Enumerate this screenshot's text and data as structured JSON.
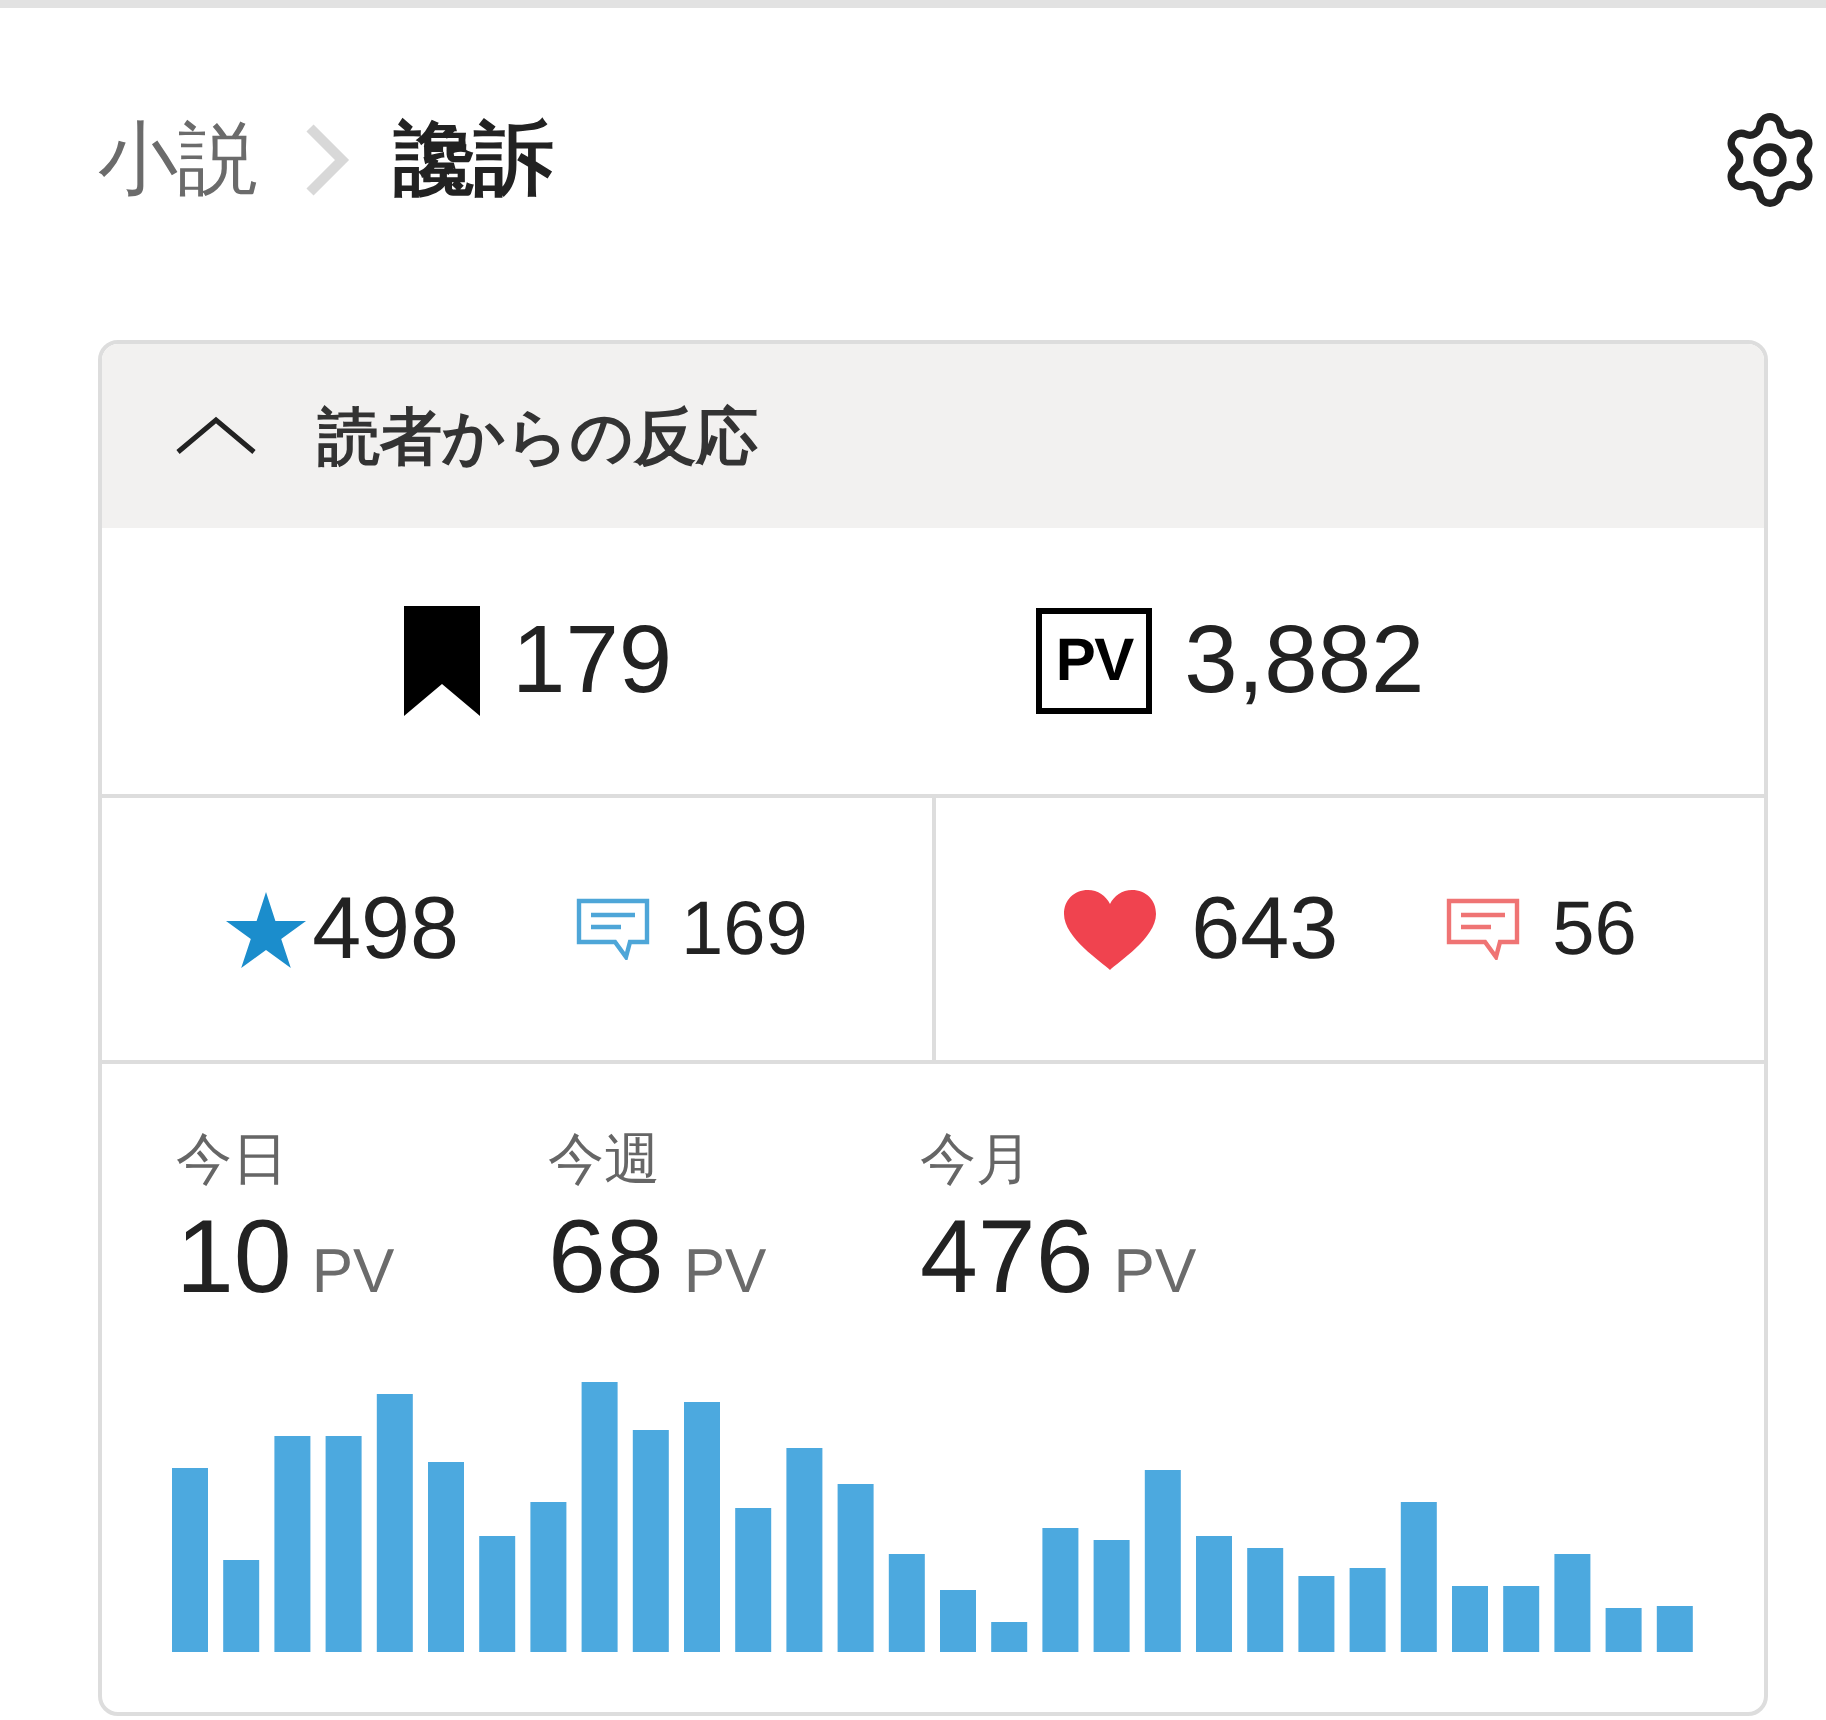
{
  "breadcrumb": [
    {
      "label": "小説",
      "current": false
    },
    {
      "label": "讒訴",
      "current": true
    }
  ],
  "panel": {
    "title": "読者からの反応",
    "expanded": true,
    "totals": [
      {
        "kind": "bookmarks",
        "value": "179"
      },
      {
        "kind": "page_views",
        "badge": "PV",
        "value": "3,882"
      }
    ],
    "reactions": [
      {
        "kind": "star",
        "count": "498",
        "comments": "169"
      },
      {
        "kind": "heart",
        "count": "643",
        "comments": "56"
      }
    ],
    "periods": [
      {
        "label": "今日",
        "value": "10",
        "unit": "PV"
      },
      {
        "label": "今週",
        "value": "68",
        "unit": "PV"
      },
      {
        "label": "今月",
        "value": "476",
        "unit": "PV"
      }
    ]
  }
}
